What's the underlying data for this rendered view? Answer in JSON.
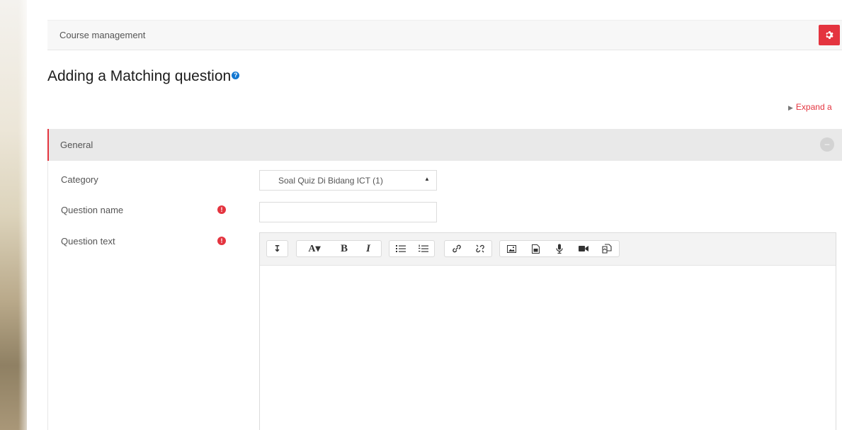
{
  "header": {
    "course_management": "Course management",
    "settings_icon": "gear-icon"
  },
  "page": {
    "title": "Adding a Matching question",
    "help_icon": "question-circle-icon",
    "expand_all": "Expand a"
  },
  "section": {
    "title": "General",
    "collapse_icon": "minus-circle-icon"
  },
  "form": {
    "category_label": "Category",
    "category_value": "Soal Quiz Di Bidang ICT (1)",
    "question_name_label": "Question name",
    "question_name_value": "",
    "question_text_label": "Question text",
    "question_text_value": "",
    "required_icon": "exclamation-circle-icon"
  },
  "editor_toolbar": {
    "show_more": "toggle-toolbar-icon",
    "font": "A▾",
    "bold": "B",
    "italic": "I",
    "unordered_list": "unordered-list-icon",
    "ordered_list": "ordered-list-icon",
    "link": "link-icon",
    "unlink": "unlink-icon",
    "image": "image-icon",
    "media": "media-icon",
    "record_audio": "microphone-icon",
    "record_video": "video-camera-icon",
    "manage_files": "manage-files-icon"
  },
  "colors": {
    "accent": "#e4343f",
    "help": "#1177d1",
    "section_bg": "#e9e9e9"
  }
}
